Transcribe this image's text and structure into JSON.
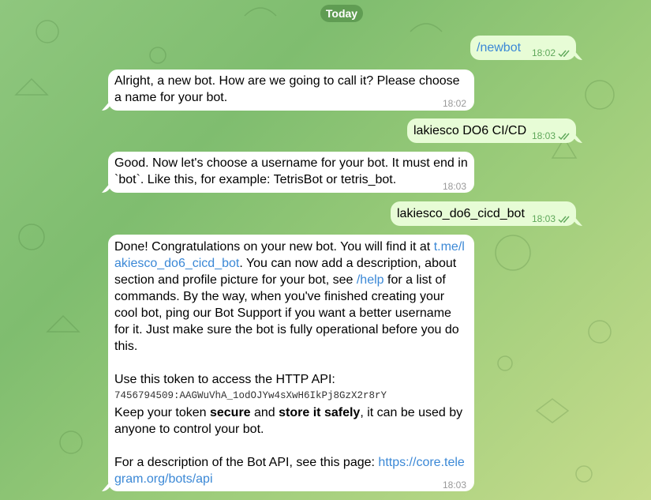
{
  "date_label": "Today",
  "messages": [
    {
      "dir": "out",
      "text": "/newbot",
      "time": "18:02",
      "is_command": true
    },
    {
      "dir": "in",
      "text": "Alright, a new bot. How are we going to call it? Please choose a name for your bot.",
      "time": "18:02"
    },
    {
      "dir": "out",
      "text": "lakiesco DO6 CI/CD",
      "time": "18:03"
    },
    {
      "dir": "in",
      "text": "Good. Now let's choose a username for your bot. It must end in `bot`. Like this, for example: TetrisBot or tetris_bot.",
      "time": "18:03"
    },
    {
      "dir": "out",
      "text": "lakiesco_do6_cicd_bot",
      "time": "18:03"
    },
    {
      "dir": "in",
      "time": "18:03",
      "p1_a": "Done! Congratulations on your new bot. You will find it at ",
      "p1_link": "t.me/lakiesco_do6_cicd_bot",
      "p1_b": ". You can now add a description, about section and profile picture for your bot, see ",
      "p1_help": "/help",
      "p1_c": " for a list of commands. By the way, when you've finished creating your cool bot, ping our Bot Support if you want a better username for it. Just make sure the bot is fully operational before you do this.",
      "p2": "Use this token to access the HTTP API:",
      "token": "7456794509:AAGWuVhA_1odOJYw4sXwH6IkPj8GzX2r8rY",
      "p3_a": "Keep your token ",
      "p3_b": "secure",
      "p3_c": " and ",
      "p3_d": "store it safely",
      "p3_e": ", it can be used by anyone to control your bot.",
      "p4": "For a description of the Bot API, see this page: ",
      "p4_link": "https://core.telegram.org/bots/api"
    }
  ],
  "colors": {
    "accent": "#3b88d6",
    "out_bubble": "#e7fcd6",
    "check": "#5fa85a"
  },
  "icons": {
    "read": "double-check-icon"
  }
}
